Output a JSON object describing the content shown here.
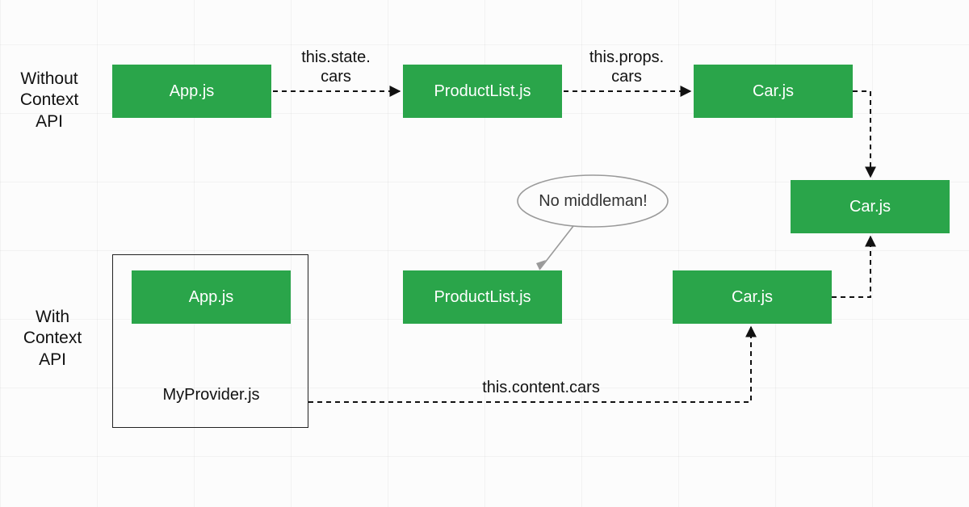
{
  "sections": {
    "without": "Without\nContext\nAPI",
    "with": "With\nContext\nAPI"
  },
  "row1": {
    "app": "App.js",
    "productList": "ProductList.js",
    "car": "Car.js",
    "edge1": "this.state.\ncars",
    "edge2": "this.props.\ncars"
  },
  "middle": {
    "car": "Car.js",
    "callout": "No middleman!"
  },
  "row2": {
    "app": "App.js",
    "provider": "MyProvider.js",
    "productList": "ProductList.js",
    "car": "Car.js",
    "edge": "this.content.cars"
  },
  "colors": {
    "green": "#2aa54a",
    "text": "#111111",
    "calloutStroke": "#888888"
  }
}
